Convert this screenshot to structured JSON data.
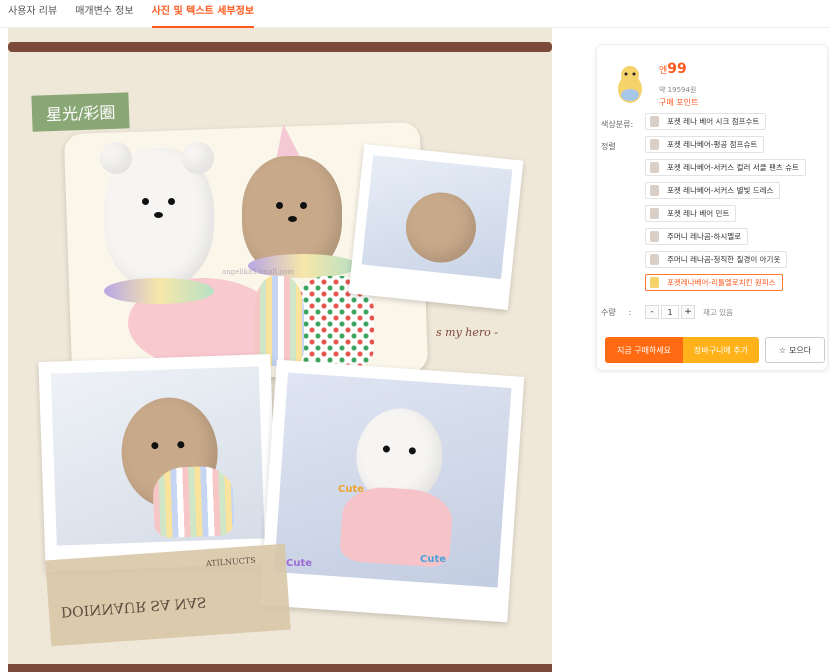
{
  "tabs": [
    {
      "label": "사용자 리뷰"
    },
    {
      "label": "매개변수 정보"
    },
    {
      "label": "사진 및 텍스트 세부정보"
    }
  ],
  "hero": {
    "title": "星光/彩圈",
    "hero_caption": "s my hero -",
    "sticker_cute_1": "Cute",
    "sticker_cute_2": "Cute",
    "sticker_cute_3": "Cute",
    "tape_text_1": "DOINNAUR SA NAS",
    "tape_text_2": "ATILNUCTS",
    "watermark": "angelika5.tmall.com",
    "colors": {
      "bg": "#efe7d8",
      "frame": "#7c4a3a",
      "label": "#8aa776"
    }
  },
  "product": {
    "price_currency": "엔",
    "price_value": "99",
    "approx_price": "약 19594원",
    "points_label": "구매 포인트",
    "option_label_1": "색상분류:",
    "option_label_2": "정렬",
    "options": [
      {
        "label": "포켓 레나 베어 시크 점프수트",
        "selected": false
      },
      {
        "label": "포켓 레나베어-평공 점프슈트",
        "selected": false
      },
      {
        "label": "포켓 레나베어-서커스 컬러 서클 팬츠 슈트",
        "selected": false
      },
      {
        "label": "포켓 레나베어-서커스 별빛 드레스",
        "selected": false
      },
      {
        "label": "포켓 레나 베어 민트",
        "selected": false
      },
      {
        "label": "주머니 레나곰-하시멜로",
        "selected": false
      },
      {
        "label": "주머니 레나곰-청직한 질경이 아기옷",
        "selected": false
      },
      {
        "label": "포켓레나베어-리틀엘로치킨 원피스",
        "selected": true
      }
    ],
    "quantity_label": "수량",
    "quantity_colon": ":",
    "quantity_minus": "-",
    "quantity_value": "1",
    "quantity_plus": "+",
    "stock_text": "재고 있음",
    "buy_now": "지금 구매하세요",
    "add_to_cart": "장바구니에 추가",
    "wishlist": "모으다",
    "accent_color": "#ff5a1f"
  }
}
